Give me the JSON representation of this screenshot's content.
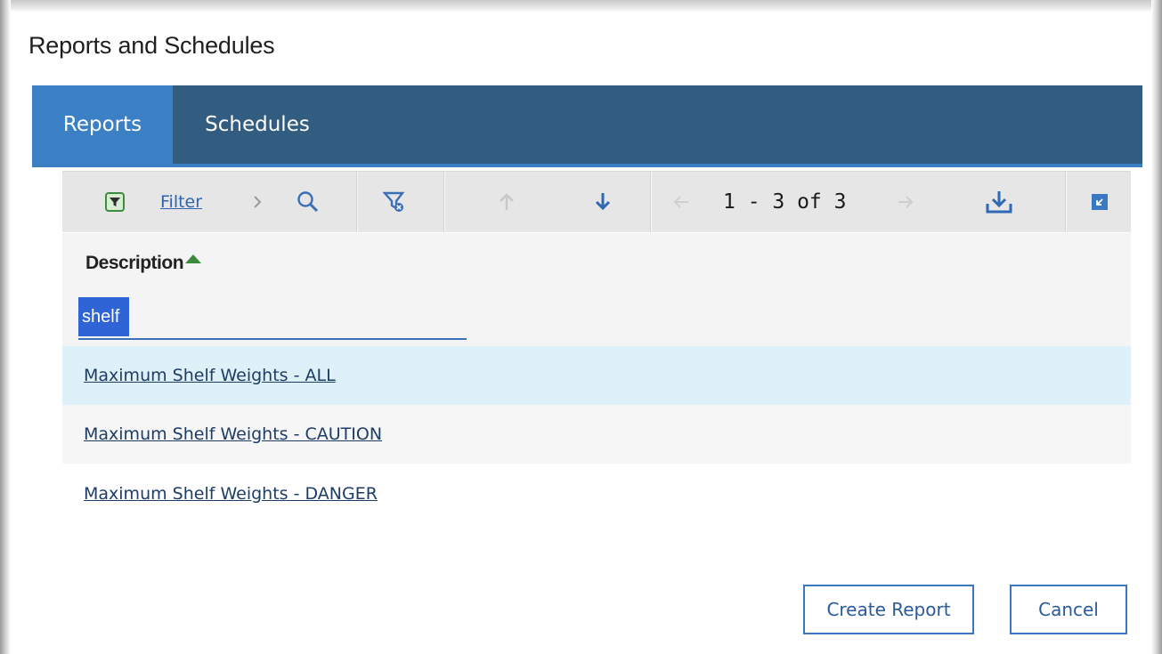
{
  "dialog": {
    "title": "Reports and Schedules"
  },
  "tabs": [
    {
      "label": "Reports",
      "active": true
    },
    {
      "label": "Schedules",
      "active": false
    }
  ],
  "toolbar": {
    "filter_label": "Filter",
    "pager_text": "1 - 3 of 3",
    "icons": [
      "filter-icon",
      "chevron-right-icon",
      "search-icon",
      "clear-filter-icon",
      "arrow-up-icon",
      "arrow-down-icon",
      "arrow-left-icon",
      "arrow-right-icon",
      "download-icon",
      "collapse-icon"
    ]
  },
  "table": {
    "column_header": "Description",
    "sort": "ascending",
    "filter_value": "shelf",
    "rows": [
      {
        "label": "Maximum Shelf Weights - ALL"
      },
      {
        "label": "Maximum Shelf Weights - CAUTION"
      },
      {
        "label": "Maximum Shelf Weights - DANGER"
      }
    ]
  },
  "actions": {
    "create_label": "Create Report",
    "cancel_label": "Cancel"
  },
  "colors": {
    "tabbar": "#325c80",
    "tab_active": "#3b7fc4",
    "link": "#2d63b3",
    "row_highlight": "#dff1f8",
    "button_border": "#3b76c0"
  }
}
